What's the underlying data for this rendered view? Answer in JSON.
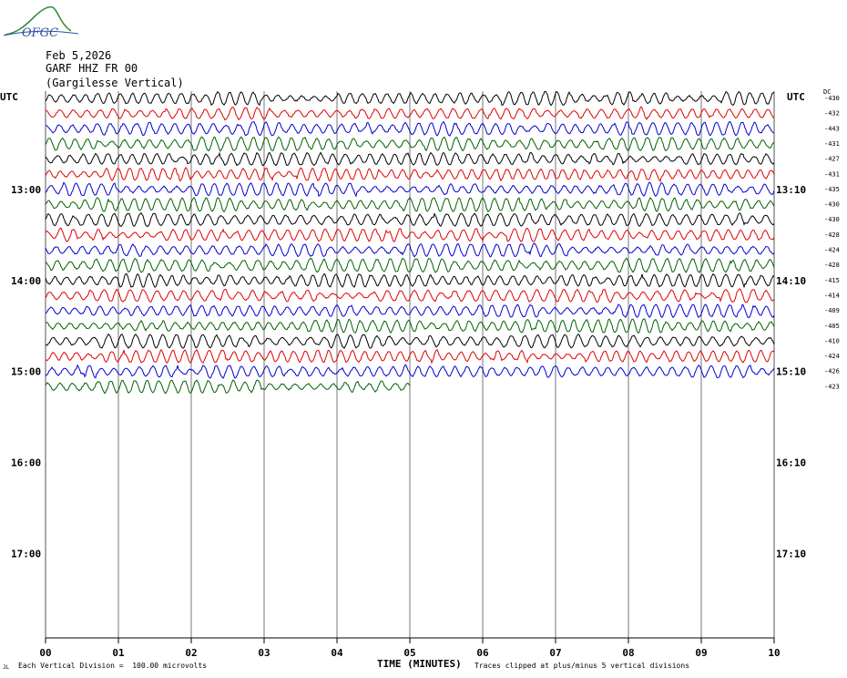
{
  "header": {
    "logo_text": "OFGC",
    "date": "Feb 5,2026",
    "station": "GARF HHZ FR 00",
    "location": "(Gargilesse Vertical)"
  },
  "axis": {
    "left_unit": "UTC",
    "right_unit": "UTC",
    "dc_label": "DC",
    "xlabel": "TIME (MINUTES)",
    "x_ticks": [
      "00",
      "01",
      "02",
      "03",
      "04",
      "05",
      "06",
      "07",
      "08",
      "09",
      "10"
    ]
  },
  "footer": {
    "scale_note": "Each Vertical Division =  100.00 microvolts",
    "clip_note": "Traces clipped at plus/minus 5 vertical divisions",
    "corner_mark": "JL"
  },
  "chart_data": {
    "type": "line",
    "title": "GARF HHZ FR 00 (Gargilesse Vertical)",
    "xlabel": "TIME (MINUTES)",
    "xlim": [
      0,
      10
    ],
    "hour_labels_left": [
      "13:00",
      "14:00",
      "15:00",
      "16:00",
      "17:00"
    ],
    "hour_labels_right": [
      "13:10",
      "14:10",
      "15:10",
      "16:10",
      "17:10"
    ],
    "trace_colors": [
      "#000000",
      "#e00000",
      "#0000d0",
      "#006000"
    ],
    "dc_offsets": [
      -430,
      -432,
      -443,
      -431,
      -427,
      -431,
      -435,
      -430,
      -430,
      -428,
      -424,
      -428,
      -415,
      -414,
      -409,
      -405,
      -410,
      -424,
      -426,
      -423
    ],
    "last_trace_end_minutes": 5.0,
    "rows": 20
  }
}
